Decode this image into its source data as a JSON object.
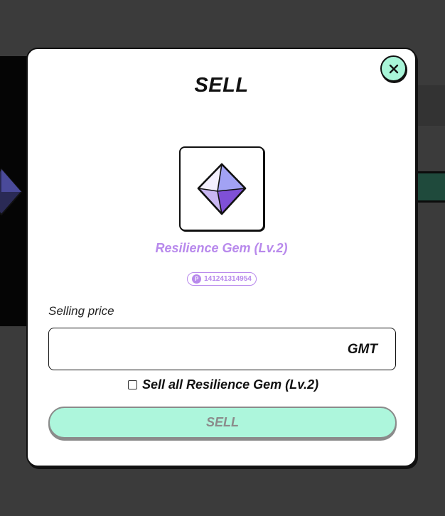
{
  "modal": {
    "title": "SELL",
    "close_icon": "close-icon",
    "item": {
      "name": "Resilience Gem (Lv.2)",
      "icon": "gem-icon",
      "token_id": "141241314954",
      "id_icon": "token-icon"
    },
    "price": {
      "label": "Selling price",
      "value": "",
      "placeholder": "",
      "currency": "GMT"
    },
    "sell_all": {
      "checked": false,
      "label": "Sell all Resilience Gem (Lv.2)"
    },
    "sell_button_label": "SELL"
  },
  "colors": {
    "accent_mint": "#adf6dc",
    "gem_purple": "#b889ec",
    "backdrop": "#3b3b3b"
  }
}
